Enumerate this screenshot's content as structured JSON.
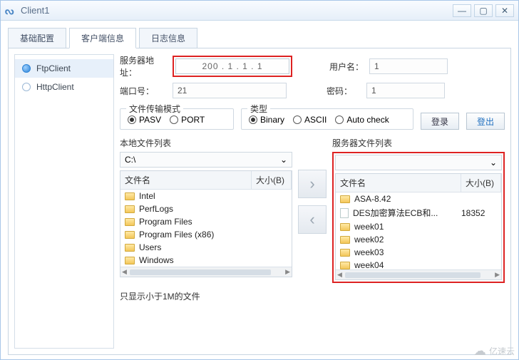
{
  "window": {
    "title": "Client1"
  },
  "tabs": {
    "items": [
      "基础配置",
      "客户端信息",
      "日志信息"
    ],
    "activeIndex": 1
  },
  "sidebar": {
    "items": [
      "FtpClient",
      "HttpClient"
    ],
    "activeIndex": 0
  },
  "form": {
    "server_label": "服务器地址：",
    "server_value": "200 .   1 .   1 .   1",
    "port_label": "端口号：",
    "port_value": "21",
    "user_label": "用户名：",
    "user_value": "1",
    "pass_label": "密码：",
    "pass_value": "1"
  },
  "transferMode": {
    "legend": "文件传输模式",
    "options": [
      "PASV",
      "PORT"
    ],
    "selected": 0
  },
  "typeMode": {
    "legend": "类型",
    "options": [
      "Binary",
      "ASCII",
      "Auto check"
    ],
    "selected": 0
  },
  "buttons": {
    "login": "登录",
    "logout": "登出"
  },
  "localFiles": {
    "title": "本地文件列表",
    "path": "C:\\",
    "cols": {
      "name": "文件名",
      "size": "大小(B)"
    },
    "rows": [
      {
        "icon": "folder",
        "name": "Intel",
        "size": ""
      },
      {
        "icon": "folder",
        "name": "PerfLogs",
        "size": ""
      },
      {
        "icon": "folder",
        "name": "Program Files",
        "size": ""
      },
      {
        "icon": "folder",
        "name": "Program Files (x86)",
        "size": ""
      },
      {
        "icon": "folder",
        "name": "Users",
        "size": ""
      },
      {
        "icon": "folder",
        "name": "Windows",
        "size": ""
      }
    ]
  },
  "serverFiles": {
    "title": "服务器文件列表",
    "path": "",
    "cols": {
      "name": "文件名",
      "size": "大小(B)"
    },
    "rows": [
      {
        "icon": "folder",
        "name": "ASA-8.42",
        "size": ""
      },
      {
        "icon": "file",
        "name": "DES加密算法ECB和...",
        "size": "18352"
      },
      {
        "icon": "folder",
        "name": "week01",
        "size": ""
      },
      {
        "icon": "folder",
        "name": "week02",
        "size": ""
      },
      {
        "icon": "folder",
        "name": "week03",
        "size": ""
      },
      {
        "icon": "folder",
        "name": "week04",
        "size": ""
      }
    ]
  },
  "hint": "只显示小于1M的文件",
  "watermark": "亿速云"
}
